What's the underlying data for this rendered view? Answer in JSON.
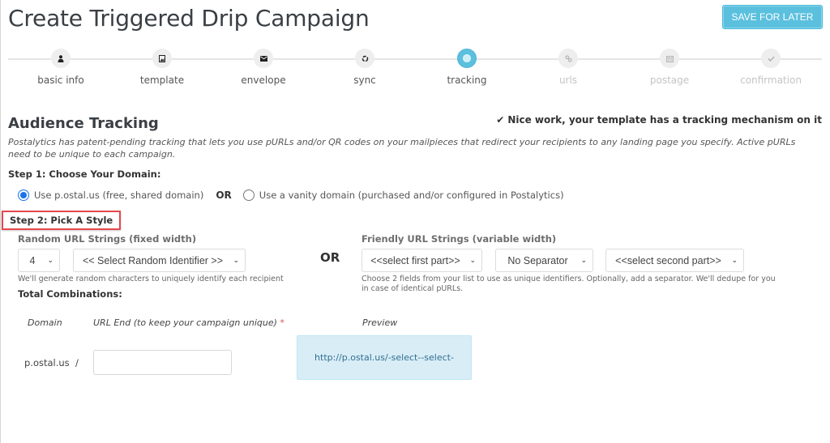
{
  "header": {
    "title": "Create Triggered Drip Campaign",
    "save_button": "SAVE FOR LATER"
  },
  "wizard": {
    "steps": [
      {
        "label": "basic info",
        "icon": "user-icon",
        "state": "complete"
      },
      {
        "label": "template",
        "icon": "image-icon",
        "state": "complete"
      },
      {
        "label": "envelope",
        "icon": "envelope-icon",
        "state": "complete"
      },
      {
        "label": "sync",
        "icon": "sync-icon",
        "state": "complete"
      },
      {
        "label": "tracking",
        "icon": "target-icon",
        "state": "active"
      },
      {
        "label": "urls",
        "icon": "link-icon",
        "state": "disabled"
      },
      {
        "label": "postage",
        "icon": "calendar-icon",
        "state": "disabled"
      },
      {
        "label": "confirmation",
        "icon": "check-icon",
        "state": "disabled"
      }
    ]
  },
  "tracking": {
    "title": "Audience Tracking",
    "status_message": "Nice work, your template has a tracking mechanism on it",
    "description": "Postalytics has patent-pending tracking that lets you use pURLs and/or QR codes on your mailpieces that redirect your recipients to any landing page you specify. Active pURLs need to be unique to each campaign.",
    "step1": {
      "label": "Step 1: Choose Your Domain:",
      "option_shared": "Use p.ostal.us (free, shared domain)",
      "or": "OR",
      "option_vanity": "Use a vanity domain (purchased and/or configured in Postalytics)",
      "selected": "shared"
    },
    "step2": {
      "label": "Step 2: Pick A Style",
      "random": {
        "label": "Random URL Strings (fixed width)",
        "length_value": "4",
        "identifier_value": "<< Select Random Identifier >>",
        "help": "We'll generate random characters to uniquely identify each recipient"
      },
      "or": "OR",
      "friendly": {
        "label": "Friendly URL Strings (variable width)",
        "first_part_value": "<<select first part>>",
        "separator_value": "No Separator",
        "second_part_value": "<<select second part>>",
        "help_line1": "Choose 2 fields from your list to use as unique identifiers. Optionally, add a separator. We'll dedupe for you",
        "help_line2": "in case of identical pURLs."
      },
      "total_combinations_label": "Total Combinations:"
    },
    "url_table": {
      "col_domain": "Domain",
      "col_url_end": "URL End (to keep your campaign unique)",
      "required_mark": "*",
      "col_preview": "Preview",
      "domain_value": "p.ostal.us",
      "slash": "/",
      "url_end_value": "",
      "preview_value": "http://p.ostal.us/-select--select-"
    }
  }
}
